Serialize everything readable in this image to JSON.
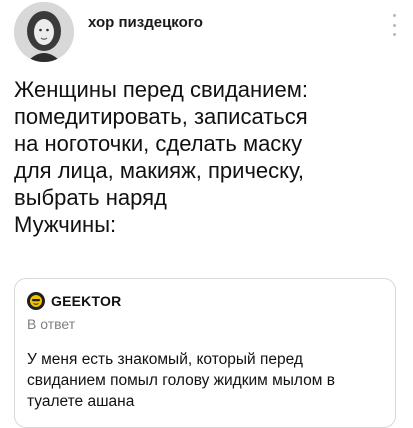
{
  "post": {
    "author": "хор пиздецкого",
    "body_lines": [
      "Женщины перед свиданием:",
      "помедитировать, записаться",
      "на ноготочки, сделать маску",
      "для лица, макияж, прическу,",
      "выбрать наряд",
      "Мужчины:"
    ]
  },
  "quoted_post": {
    "source": "GEEKTOR",
    "context": "В ответ",
    "text": "У меня есть знакомый, который перед свиданием помыл голову жидким мылом в туалете ашана"
  },
  "icons": {
    "more": "more-vertical-icon",
    "source_logo": "geektor-logo-icon"
  }
}
